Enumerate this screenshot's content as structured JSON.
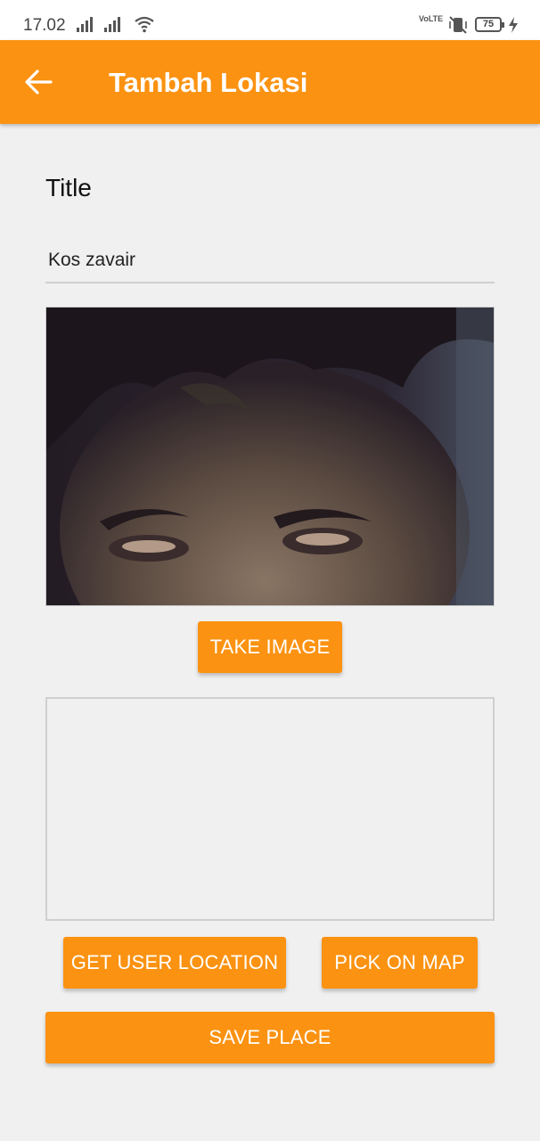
{
  "status_bar": {
    "time": "17.02",
    "network_badge": "VoLTE",
    "battery_level": "75",
    "icons": [
      "signal-icon",
      "signal-icon",
      "wifi-icon",
      "volte-icon",
      "mute-vibrate-icon",
      "battery-icon",
      "charging-bolt-icon"
    ]
  },
  "app_bar": {
    "title": "Tambah Lokasi",
    "back_icon": "arrow-left-icon",
    "color": "#fb9211"
  },
  "form": {
    "title_label": "Title",
    "title_value": "Kos zavair",
    "image_alt": "photo",
    "take_image_label": "TAKE IMAGE",
    "get_user_location_label": "GET USER LOCATION",
    "pick_on_map_label": "PICK ON MAP",
    "save_place_label": "SAVE PLACE"
  },
  "colors": {
    "accent": "#fb9211",
    "background": "#f0f0f0"
  }
}
